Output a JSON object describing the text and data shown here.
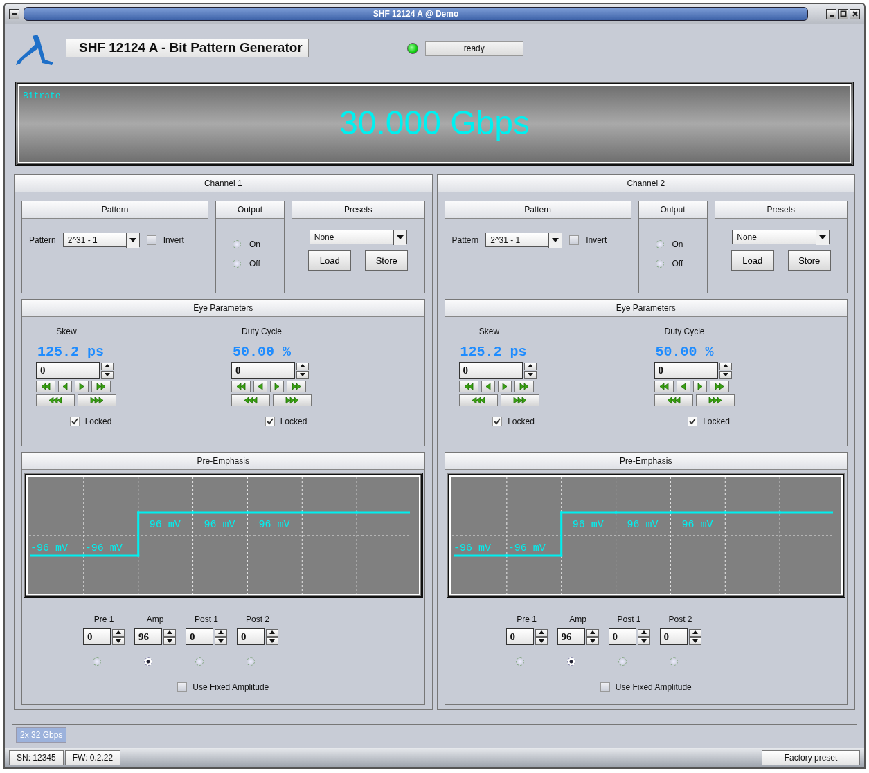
{
  "window": {
    "title": "SHF 12124 A @ Demo"
  },
  "header": {
    "title": "SHF 12124 A - Bit Pattern Generator",
    "led_on": true,
    "status": "ready"
  },
  "bitrate": {
    "label": "Bitrate",
    "value": "30.000 Gbps"
  },
  "channels": [
    {
      "title": "Channel 1",
      "pattern": {
        "title": "Pattern",
        "label": "Pattern",
        "value": "2^31 - 1",
        "invert_label": "Invert",
        "invert": false
      },
      "output": {
        "title": "Output",
        "options": [
          {
            "label": "On",
            "selected": false
          },
          {
            "label": "Off",
            "selected": false
          }
        ]
      },
      "presets": {
        "title": "Presets",
        "value": "None",
        "buttons": [
          "Load",
          "Store"
        ]
      },
      "eye": {
        "title": "Eye Parameters",
        "params": [
          {
            "label": "Skew",
            "reading": "125.2 ps",
            "value": "0",
            "locked_label": "Locked",
            "locked": true
          },
          {
            "label": "Duty Cycle",
            "reading": "50.00 %",
            "value": "0",
            "locked_label": "Locked",
            "locked": true
          }
        ]
      },
      "pre_emphasis": {
        "title": "Pre-Emphasis",
        "segments": [
          {
            "label": "-96 mV",
            "high": false
          },
          {
            "label": "-96 mV",
            "high": false
          },
          {
            "label": "96 mV",
            "high": true
          },
          {
            "label": "96 mV",
            "high": true
          },
          {
            "label": "96 mV",
            "high": true
          },
          {
            "high": true
          },
          {
            "high": true
          }
        ],
        "taps": [
          {
            "label": "Pre 1",
            "value": "0",
            "selected": false
          },
          {
            "label": "Amp",
            "value": "96",
            "selected": true
          },
          {
            "label": "Post 1",
            "value": "0",
            "selected": false
          },
          {
            "label": "Post 2",
            "value": "0",
            "selected": false
          }
        ],
        "fixed_label": "Use Fixed Amplitude",
        "fixed": false
      }
    },
    {
      "title": "Channel 2",
      "pattern": {
        "title": "Pattern",
        "label": "Pattern",
        "value": "2^31 - 1",
        "invert_label": "Invert",
        "invert": false
      },
      "output": {
        "title": "Output",
        "options": [
          {
            "label": "On",
            "selected": false
          },
          {
            "label": "Off",
            "selected": false
          }
        ]
      },
      "presets": {
        "title": "Presets",
        "value": "None",
        "buttons": [
          "Load",
          "Store"
        ]
      },
      "eye": {
        "title": "Eye Parameters",
        "params": [
          {
            "label": "Skew",
            "reading": "125.2 ps",
            "value": "0",
            "locked_label": "Locked",
            "locked": true
          },
          {
            "label": "Duty Cycle",
            "reading": "50.00 %",
            "value": "0",
            "locked_label": "Locked",
            "locked": true
          }
        ]
      },
      "pre_emphasis": {
        "title": "Pre-Emphasis",
        "segments": [
          {
            "label": "-96 mV",
            "high": false
          },
          {
            "label": "-96 mV",
            "high": false
          },
          {
            "label": "96 mV",
            "high": true
          },
          {
            "label": "96 mV",
            "high": true
          },
          {
            "label": "96 mV",
            "high": true
          },
          {
            "high": true
          },
          {
            "high": true
          }
        ],
        "taps": [
          {
            "label": "Pre 1",
            "value": "0",
            "selected": false
          },
          {
            "label": "Amp",
            "value": "96",
            "selected": true
          },
          {
            "label": "Post 1",
            "value": "0",
            "selected": false
          },
          {
            "label": "Post 2",
            "value": "0",
            "selected": false
          }
        ],
        "fixed_label": "Use Fixed Amplitude",
        "fixed": false
      }
    }
  ],
  "tabs": [
    {
      "label": "2x 32 Gbps",
      "selected": true
    }
  ],
  "status_bar": {
    "left": [
      "SN: 12345",
      "FW: 0.2.22"
    ],
    "right": "Factory preset"
  }
}
